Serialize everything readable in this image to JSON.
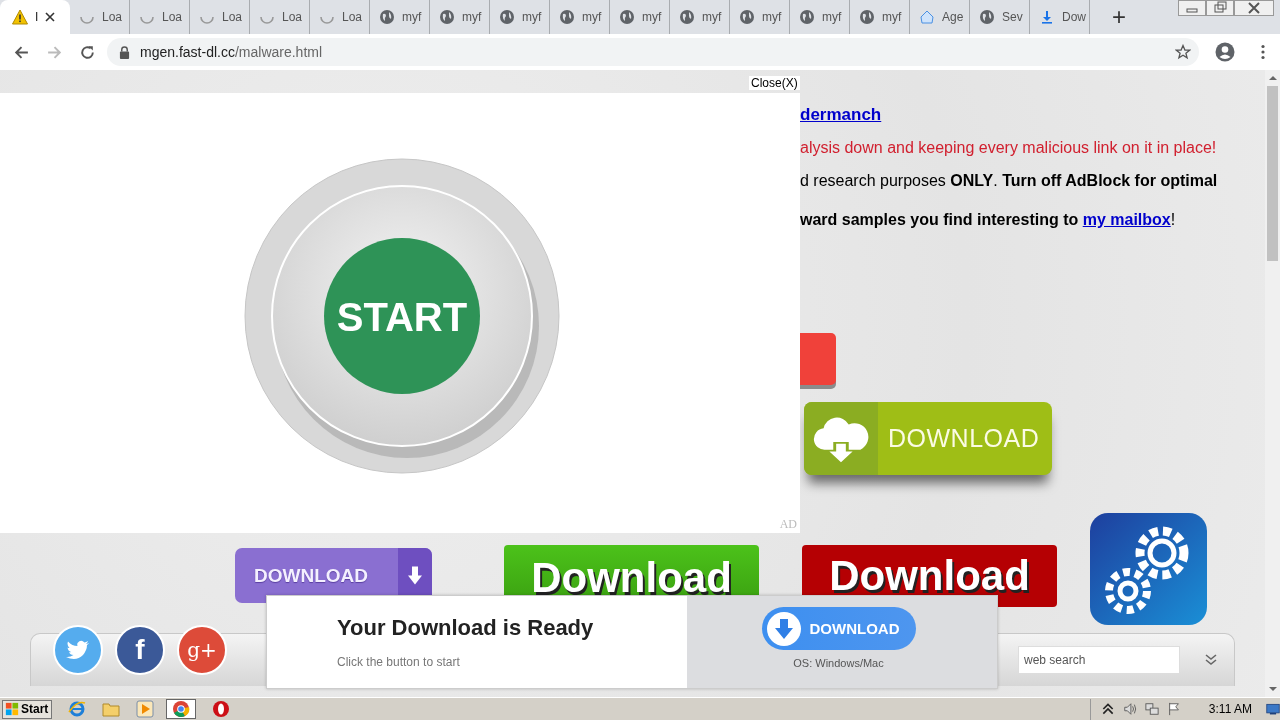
{
  "browser": {
    "tabs": [
      {
        "label": "I",
        "kind": "warning",
        "selected": true
      },
      {
        "label": "Loa",
        "kind": "loading",
        "selected": false
      },
      {
        "label": "Loa",
        "kind": "loading",
        "selected": false
      },
      {
        "label": "Loa",
        "kind": "loading",
        "selected": false
      },
      {
        "label": "Loa",
        "kind": "loading",
        "selected": false
      },
      {
        "label": "Loa",
        "kind": "loading",
        "selected": false
      },
      {
        "label": "myf",
        "kind": "globe",
        "selected": false
      },
      {
        "label": "myf",
        "kind": "globe",
        "selected": false
      },
      {
        "label": "myf",
        "kind": "globe",
        "selected": false
      },
      {
        "label": "myf",
        "kind": "globe",
        "selected": false
      },
      {
        "label": "myf",
        "kind": "globe",
        "selected": false
      },
      {
        "label": "myf",
        "kind": "globe",
        "selected": false
      },
      {
        "label": "myf",
        "kind": "globe",
        "selected": false
      },
      {
        "label": "myf",
        "kind": "globe",
        "selected": false
      },
      {
        "label": "myf",
        "kind": "globe",
        "selected": false
      },
      {
        "label": "Age",
        "kind": "app",
        "selected": false
      },
      {
        "label": "Sev",
        "kind": "globe",
        "selected": false
      },
      {
        "label": "Dow",
        "kind": "download",
        "selected": false
      }
    ],
    "new_tab": "+",
    "address": {
      "host": "mgen.fast-dl.cc",
      "path": "/malware.html"
    }
  },
  "page": {
    "author_link": "dermanch",
    "warning": "alysis down and keeping every malicious link on it in place!",
    "notice": "d research purposes **ONLY**. **Turn off AdBlock for optimal**",
    "contact": "ward samples you find interesting to",
    "contact_link": "my mailbox",
    "contact_end": "!",
    "cloud_button": "DOWNLOAD",
    "download_buttons": [
      {
        "label": "DOWNLOAD",
        "kind": "purple"
      },
      {
        "label": "Download",
        "kind": "green"
      },
      {
        "label": "Download",
        "kind": "red"
      }
    ],
    "social": [
      {
        "kind": "twitter"
      },
      {
        "kind": "facebook",
        "label": "f"
      },
      {
        "kind": "google",
        "label": "g+"
      }
    ],
    "search": {
      "placeholder": "web search"
    }
  },
  "ad": {
    "close": "Close(X)",
    "button": "START",
    "badge": "AD"
  },
  "notification": {
    "title": "Your Download is Ready",
    "subtitle": "Click the button to start",
    "button": "DOWNLOAD",
    "note": "OS: Windows/Mac"
  },
  "taskbar": {
    "start": "Start",
    "clock": "3:11 AM"
  }
}
